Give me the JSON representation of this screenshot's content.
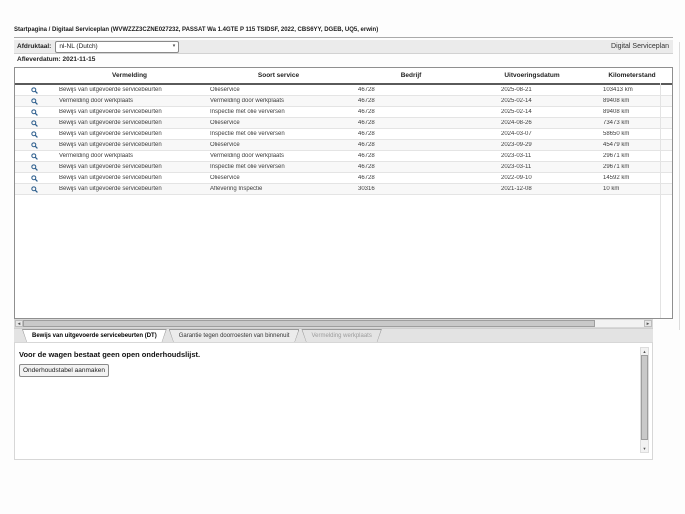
{
  "page": {
    "breadcrumb": "Startpagina / Digitaal Serviceplan (WVWZZZ3CZNE027232, PASSAT Wa 1.4GTE P 115 TSIDSF, 2022, CBS6YY, DGEB, UQ5, erwin)",
    "title_right": "Digital Serviceplan"
  },
  "toolbar": {
    "language_label": "Afdruktaal:",
    "language_value": "nl-NL (Dutch)",
    "delivery_date": "Afleverdatum: 2021-11-15"
  },
  "table": {
    "headers": [
      "Vermelding",
      "Soort service",
      "Bedrijf",
      "Uitvoeringsdatum",
      "Kilometerstand"
    ],
    "rows": [
      {
        "vermelding": "Bewijs van uitgevoerde servicebeurten",
        "soort": "Olieservice",
        "bedrijf": "46728",
        "datum": "2025-08-21",
        "km": "103413 km"
      },
      {
        "vermelding": "Vermelding door werkplaats",
        "soort": "Vermelding door werkplaats",
        "bedrijf": "46728",
        "datum": "2025-02-14",
        "km": "89408 km"
      },
      {
        "vermelding": "Bewijs van uitgevoerde servicebeurten",
        "soort": "Inspectie met olie verversen",
        "bedrijf": "46728",
        "datum": "2025-02-14",
        "km": "89408 km"
      },
      {
        "vermelding": "Bewijs van uitgevoerde servicebeurten",
        "soort": "Olieservice",
        "bedrijf": "46728",
        "datum": "2024-08-26",
        "km": "73473 km"
      },
      {
        "vermelding": "Bewijs van uitgevoerde servicebeurten",
        "soort": "Inspectie met olie verversen",
        "bedrijf": "46728",
        "datum": "2024-03-07",
        "km": "58650 km"
      },
      {
        "vermelding": "Bewijs van uitgevoerde servicebeurten",
        "soort": "Olieservice",
        "bedrijf": "46728",
        "datum": "2023-09-29",
        "km": "45479 km"
      },
      {
        "vermelding": "Vermelding door werkplaats",
        "soort": "Vermelding door werkplaats",
        "bedrijf": "46728",
        "datum": "2023-03-11",
        "km": "29671 km"
      },
      {
        "vermelding": "Bewijs van uitgevoerde servicebeurten",
        "soort": "Inspectie met olie verversen",
        "bedrijf": "46728",
        "datum": "2023-03-11",
        "km": "29671 km"
      },
      {
        "vermelding": "Bewijs van uitgevoerde servicebeurten",
        "soort": "Olieservice",
        "bedrijf": "46728",
        "datum": "2022-09-10",
        "km": "14592 km"
      },
      {
        "vermelding": "Bewijs van uitgevoerde servicebeurten",
        "soort": "Aflevering Inspectie",
        "bedrijf": "30316",
        "datum": "2021-12-08",
        "km": "10 km"
      }
    ]
  },
  "tabs": [
    {
      "label": "Bewijs van uitgevoerde servicebeurten (DT)",
      "state": "active"
    },
    {
      "label": "Garantie tegen doorroesten van binnenuit",
      "state": "normal"
    },
    {
      "label": "Vermelding werkplaats",
      "state": "disabled"
    }
  ],
  "bottom_panel": {
    "message": "Voor de wagen bestaat geen open onderhoudslijst.",
    "button_label": "Onderhoudstabel aanmaken"
  },
  "icons": {
    "dropdown_arrow": "▾",
    "scroll_left": "◄",
    "scroll_right": "►",
    "scroll_up": "▲",
    "scroll_down": "▼"
  },
  "colors": {
    "toolbar_bg": "#ebebeb",
    "magnifier_blue": "#2d5e8d",
    "header_rule": "#5a5a5a",
    "tabstrip_bg": "#e3e3e3"
  }
}
